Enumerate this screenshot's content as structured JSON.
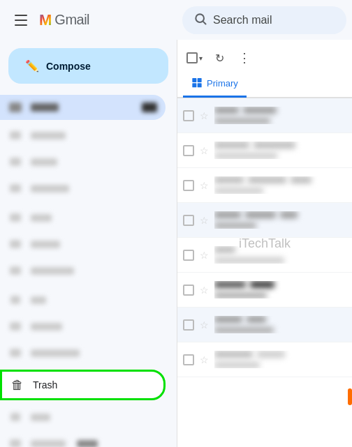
{
  "app": {
    "title": "Gmail",
    "logo_m": "M",
    "logo_text": "Gmail"
  },
  "search": {
    "placeholder": "Search mail"
  },
  "compose": {
    "label": "Compose"
  },
  "sidebar": {
    "items": [
      {
        "id": "inbox",
        "label": "Inbox",
        "active": true
      },
      {
        "id": "starred",
        "label": "Starred"
      },
      {
        "id": "snoozed",
        "label": "Snoozed"
      },
      {
        "id": "sent",
        "label": "Sent"
      },
      {
        "id": "drafts",
        "label": "Drafts"
      }
    ],
    "trash": {
      "label": "Trash"
    }
  },
  "toolbar": {
    "select_all_label": "Select all",
    "refresh_label": "Refresh",
    "more_label": "More options"
  },
  "tabs": [
    {
      "id": "primary",
      "label": "Primary",
      "active": true
    }
  ],
  "watermark": "iTechTalk"
}
